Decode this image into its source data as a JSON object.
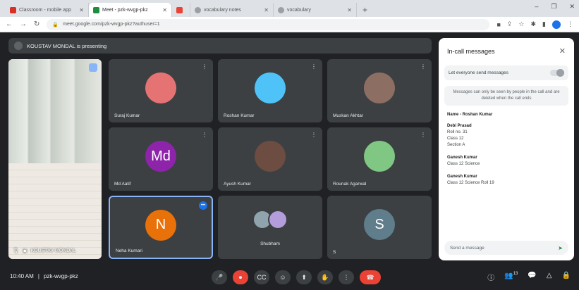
{
  "browser": {
    "tabs": [
      {
        "label": "Classroom - mobile app",
        "color": "#d93025"
      },
      {
        "label": "Meet - pzk-wvgp-pkz",
        "color": "#1e8e3e"
      },
      {
        "label": "",
        "color": "#ea4335"
      },
      {
        "label": "vocabulary notes",
        "color": "#9aa0a6"
      },
      {
        "label": "vocabulary",
        "color": "#9aa0a6"
      }
    ],
    "new_tab": "+",
    "url": "meet.google.com/pzk-wvgp-pkz?authuser=1",
    "window_controls": [
      "–",
      "❐",
      "✕"
    ]
  },
  "presenter": {
    "text": "KOUSTAV MONDAL is presenting"
  },
  "share": {
    "label": "KOUSTAV MONDAL"
  },
  "participants": [
    {
      "name": "Suraj Kumar",
      "kind": "photo",
      "color": "#e57373"
    },
    {
      "name": "Roshan Kumar",
      "kind": "photo",
      "color": "#4fc3f7"
    },
    {
      "name": "Muskan Akhtar",
      "kind": "photo",
      "color": "#8d6e63"
    },
    {
      "name": "Md Aatif",
      "kind": "initials",
      "initials": "Md",
      "color": "#8e24aa"
    },
    {
      "name": "Ayush Kumar",
      "kind": "photo",
      "color": "#6d4c41"
    },
    {
      "name": "Rounak Agarwal",
      "kind": "photo",
      "color": "#81c784"
    },
    {
      "name": "Neha Kumari",
      "kind": "initials",
      "initials": "N",
      "color": "#e8710a"
    },
    {
      "name": "Shubham",
      "kind": "pair",
      "color": "#b39ddb"
    },
    {
      "name": "S",
      "kind": "initials",
      "initials": "S",
      "color": "#607d8b"
    }
  ],
  "chat": {
    "title": "In-call messages",
    "toggle_label": "Let everyone send messages",
    "notice": "Messages can only be seen by people in the call and are deleted when the call ends",
    "messages": [
      {
        "who": "Name - Roshan Kumar",
        "lines": []
      },
      {
        "who": "Debi Prasad",
        "lines": [
          "Roll no. 31",
          "Class 12",
          "Section A"
        ]
      },
      {
        "who": "Ganesh Kumar",
        "lines": [
          "Class 12 Science"
        ]
      },
      {
        "who": "Ganesh Kumar",
        "lines": [
          "Class 12 Science Roll 19"
        ]
      }
    ],
    "input_placeholder": "Send a message",
    "send_icon": "send-icon"
  },
  "bottom": {
    "time": "10:40 AM",
    "meeting_code": "pzk-wvgp-pkz"
  },
  "controls": {
    "mic": "🎤",
    "cam": "⏺",
    "cc": "CC",
    "emoji": "☺",
    "present": "⬆",
    "hand": "✋",
    "more": "⋮",
    "end": "☎"
  },
  "right_controls": {
    "info": "ⓘ",
    "people": "👥",
    "people_count": "13",
    "chat": "💬",
    "activities": "△",
    "host": "🔒"
  }
}
